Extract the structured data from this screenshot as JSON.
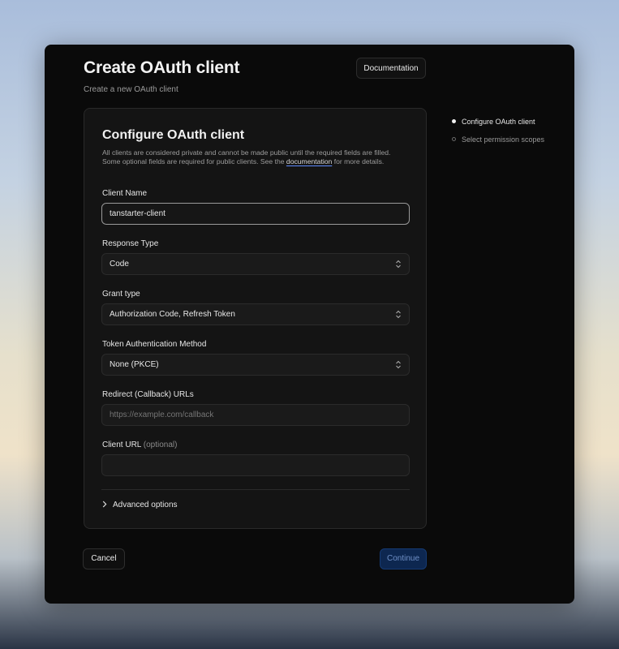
{
  "header": {
    "title": "Create OAuth client",
    "subtitle": "Create a new OAuth client",
    "documentation_label": "Documentation"
  },
  "card": {
    "title": "Configure OAuth client",
    "description_before": "All clients are considered private and cannot be made public until the required fields are filled. Some optional fields are required for public clients. See the ",
    "description_link": "documentation",
    "description_after": " for more details."
  },
  "fields": {
    "client_name": {
      "label": "Client Name",
      "value": "tanstarter-client"
    },
    "response_type": {
      "label": "Response Type",
      "value": "Code"
    },
    "grant_type": {
      "label": "Grant type",
      "value": "Authorization Code, Refresh Token"
    },
    "token_auth": {
      "label": "Token Authentication Method",
      "value": "None (PKCE)"
    },
    "redirect_urls": {
      "label": "Redirect (Callback) URLs",
      "value": "",
      "placeholder": "https://example.com/callback"
    },
    "client_url": {
      "label": "Client URL",
      "optional": "(optional)",
      "value": ""
    }
  },
  "advanced_label": "Advanced options",
  "actions": {
    "cancel_label": "Cancel",
    "continue_label": "Continue"
  },
  "steps": [
    {
      "label": "Configure OAuth client",
      "state": "active"
    },
    {
      "label": "Select permission scopes",
      "state": "inactive"
    }
  ],
  "colors": {
    "window_bg": "#0a0a0a",
    "card_bg": "#141414",
    "primary_button": "#0d2750",
    "link_underline": "#5f8cff"
  }
}
